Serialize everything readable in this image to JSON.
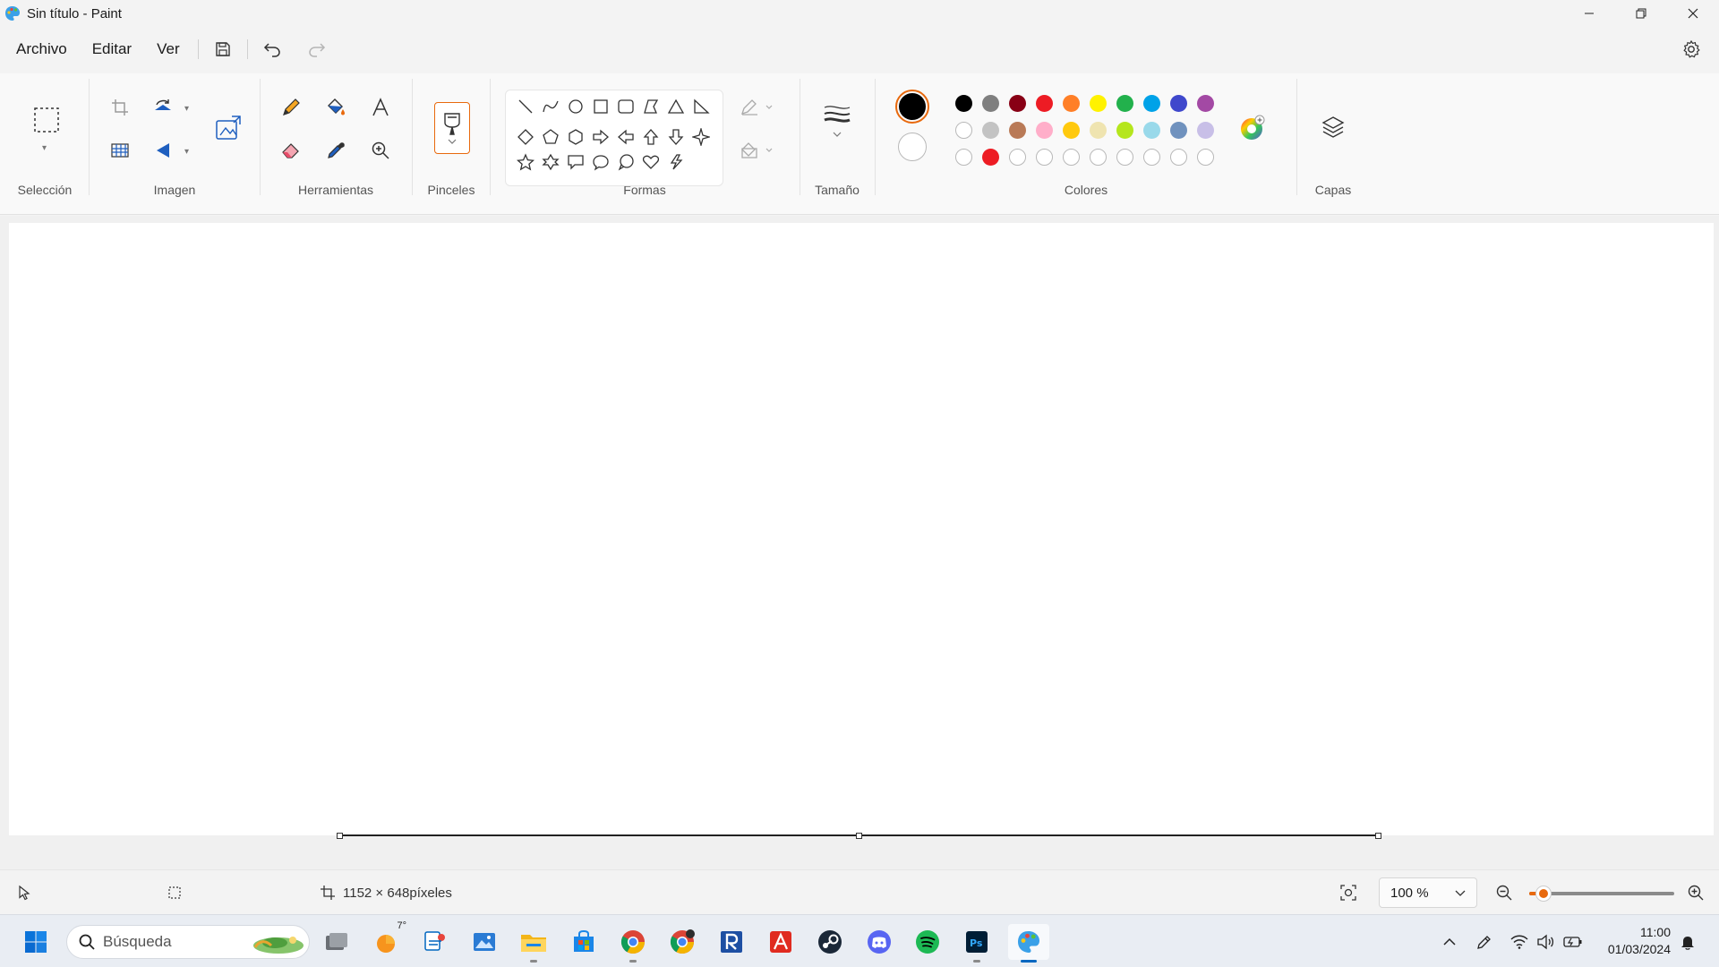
{
  "window": {
    "title": "Sin título - Paint",
    "app_icon": "paint-icon",
    "controls": [
      "minimize-icon",
      "restore-icon",
      "close-icon"
    ]
  },
  "menu": {
    "items": [
      "Archivo",
      "Editar",
      "Ver"
    ],
    "quick_actions": [
      "save-icon",
      "undo-icon",
      "redo-icon"
    ],
    "settings_icon": "gear-icon"
  },
  "ribbon": {
    "groups": {
      "seleccion": "Selección",
      "imagen": "Imagen",
      "herramientas": "Herramientas",
      "pinceles": "Pinceles",
      "formas": "Formas",
      "tamano": "Tamaño",
      "colores": "Colores",
      "capas": "Capas"
    },
    "tools": [
      "select-rectangle-icon",
      "crop-icon",
      "rotate-icon",
      "resize-icon",
      "flip-icon",
      "image-ai-icon",
      "pencil-icon",
      "fill-icon",
      "text-icon",
      "eraser-icon",
      "color-picker-icon",
      "magnifier-icon",
      "brush-icon",
      "outline-icon",
      "fill-style-icon",
      "size-icon",
      "color-wheel-icon",
      "layers-icon"
    ],
    "shapes": [
      "line",
      "curve",
      "oval",
      "rectangle",
      "rounded-rectangle",
      "polygon",
      "triangle",
      "right-triangle",
      "diamond",
      "pentagon",
      "hexagon",
      "right-arrow",
      "left-arrow",
      "up-arrow",
      "down-arrow",
      "four-point-star",
      "five-point-star",
      "six-point-star",
      "rectangular-callout",
      "oval-callout",
      "cloud-callout",
      "heart",
      "lightning"
    ],
    "colors": {
      "primary": "#000000",
      "secondary": "#ffffff",
      "row1": [
        "#000000",
        "#7f7f7f",
        "#880015",
        "#ed1c24",
        "#ff7f27",
        "#fff200",
        "#22b14c",
        "#00a2e8",
        "#3f48cc",
        "#a349a4"
      ],
      "row2": [
        "#ffffff",
        "#c3c3c3",
        "#b97a57",
        "#ffaec9",
        "#ffc90e",
        "#efe4b0",
        "#b5e61d",
        "#99d9ea",
        "#7092be",
        "#c8bfe7"
      ],
      "row3": [
        "",
        "#ed1c24",
        "",
        "",
        "",
        "",
        "",
        "",
        "",
        ""
      ]
    }
  },
  "status": {
    "pointer_icon": "pointer-icon",
    "selection_icon": "selection-size-icon",
    "canvas_size": "1152 × 648píxeles",
    "zoom": "100 %",
    "zoom_level": 0.1
  },
  "taskbar": {
    "search_placeholder": "Búsqueda",
    "badge": "7°",
    "time": "11:00",
    "date": "01/03/2024",
    "apps": [
      "task-view-icon",
      "weather-icon",
      "snipping-icon",
      "photos-icon",
      "file-explorer-icon",
      "store-icon",
      "chrome-icon",
      "chrome-profile-icon",
      "revit-icon",
      "acrobat-icon",
      "steam-icon",
      "discord-icon",
      "spotify-icon",
      "photoshop-icon",
      "paint-icon"
    ]
  }
}
